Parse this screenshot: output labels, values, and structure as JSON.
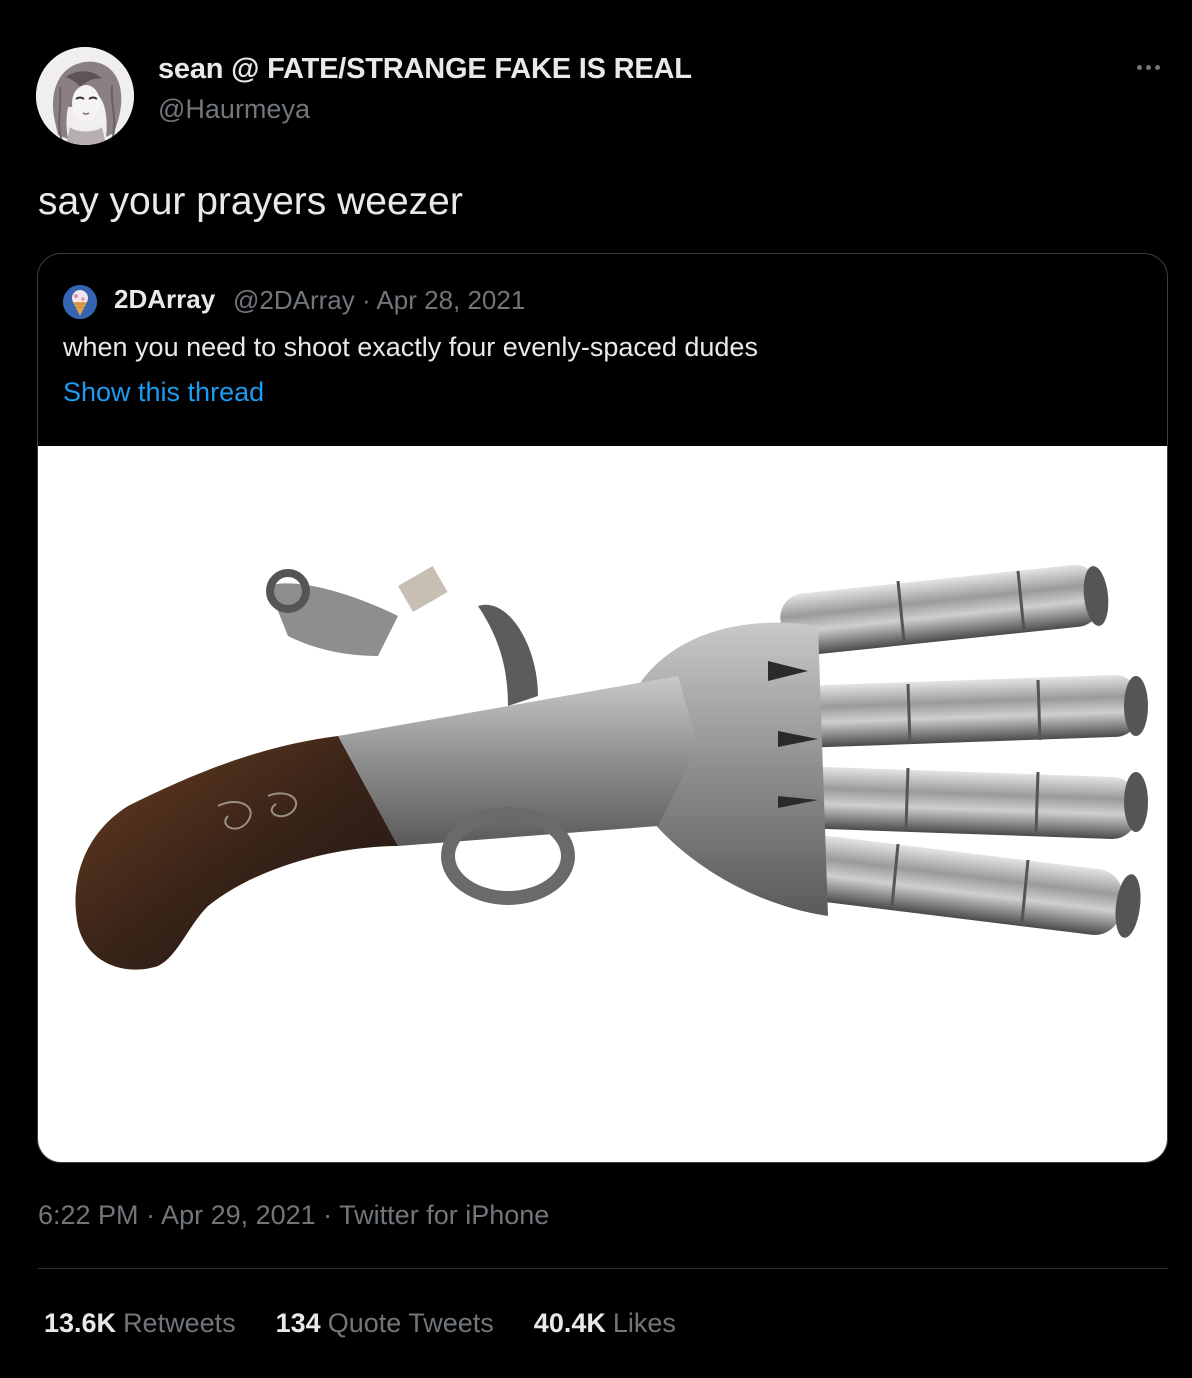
{
  "author": {
    "display_name": "sean @ FATE/STRANGE FAKE IS REAL",
    "handle": "@Haurmeya",
    "avatar_icon": "anime-sketch-avatar"
  },
  "tweet": {
    "text": "say your prayers weezer",
    "more_icon": "ellipsis-icon"
  },
  "quote": {
    "name": "2DArray",
    "meta": "@2DArray · Apr 28, 2021",
    "text": "when you need to shoot exactly four evenly-spaced dudes",
    "show_thread": "Show this thread",
    "media_description_icon": "four-barrel-flintlock-pistol-image"
  },
  "timestamp": "6:22 PM · Apr 29, 2021 · Twitter for iPhone",
  "stats": {
    "retweets_count": "13.6K",
    "retweets_label": "Retweets",
    "quotes_count": "134",
    "quotes_label": "Quote Tweets",
    "likes_count": "40.4K",
    "likes_label": "Likes"
  },
  "colors": {
    "background": "#000000",
    "text": "#e7e9ea",
    "secondary": "#71767b",
    "link": "#1d9bf0",
    "border": "#3b3f44"
  }
}
